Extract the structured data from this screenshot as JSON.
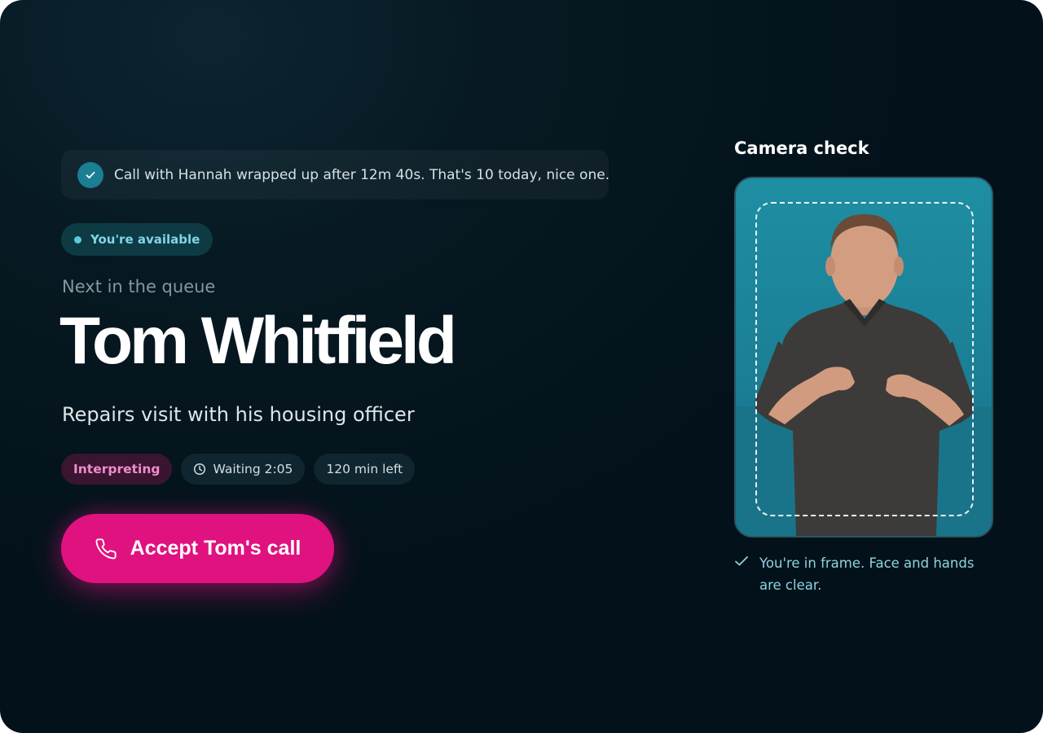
{
  "notification": {
    "icon": "check-circle-icon",
    "text": "Call with Hannah wrapped up after 12m 40s. That's 10 today, nice one."
  },
  "availability": {
    "label": "You're available",
    "color": "#5ec8dc"
  },
  "queue": {
    "label": "Next in the queue",
    "caller_name": "Tom Whitfield",
    "purpose": "Repairs visit with his housing officer",
    "chips": {
      "service": "Interpreting",
      "wait_time": "Waiting 2:05",
      "minutes_left": "120 min left"
    }
  },
  "accept_button": {
    "label": "Accept Tom's call",
    "icon": "phone-icon",
    "color": "#e0127f"
  },
  "camera": {
    "title": "Camera check",
    "status_icon": "check-icon",
    "status_text": "You're in frame. Face and hands are clear."
  },
  "colors": {
    "background": "#04141c",
    "accent_pink": "#e0127f",
    "accent_teal": "#1b7e92"
  }
}
